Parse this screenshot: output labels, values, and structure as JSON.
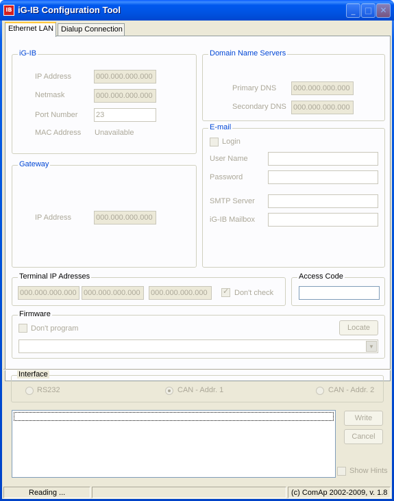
{
  "window": {
    "title": "iG-IB Configuration Tool",
    "icon_text": "IB",
    "icon": "app-icon"
  },
  "tabs": [
    {
      "label": "Ethernet LAN",
      "active": true
    },
    {
      "label": "Dialup Connection",
      "active": false
    }
  ],
  "igib": {
    "legend": "iG-IB",
    "ip_label": "IP Address",
    "ip_value": "000.000.000.000",
    "netmask_label": "Netmask",
    "netmask_value": "000.000.000.000",
    "port_label": "Port Number",
    "port_value": "23",
    "mac_label": "MAC Address",
    "mac_value": "Unavailable"
  },
  "dns": {
    "legend": "Domain Name Servers",
    "primary_label": "Primary DNS",
    "primary_value": "000.000.000.000",
    "secondary_label": "Secondary DNS",
    "secondary_value": "000.000.000.000"
  },
  "gateway": {
    "legend": "Gateway",
    "ip_label": "IP Address",
    "ip_value": "000.000.000.000"
  },
  "email": {
    "legend": "E-mail",
    "login_label": "Login",
    "user_label": "User Name",
    "user_value": "",
    "password_label": "Password",
    "password_value": "",
    "smtp_label": "SMTP Server",
    "smtp_value": "",
    "mailbox_label": "iG-IB Mailbox",
    "mailbox_value": ""
  },
  "terminal": {
    "legend": "Terminal IP Adresses",
    "ips": [
      "000.000.000.000",
      "000.000.000.000",
      "000.000.000.000"
    ],
    "dont_check_label": "Don't check",
    "dont_check_checked": true
  },
  "access": {
    "legend": "Access Code",
    "value": ""
  },
  "firmware": {
    "legend": "Firmware",
    "dont_program_label": "Don't program",
    "locate_label": "Locate",
    "path_value": ""
  },
  "interface": {
    "legend": "Interface",
    "options": [
      {
        "label": "RS232",
        "checked": false
      },
      {
        "label": "CAN - Addr. 1",
        "checked": true
      },
      {
        "label": "CAN - Addr. 2",
        "checked": false
      }
    ]
  },
  "actions": {
    "write_label": "Write",
    "cancel_label": "Cancel",
    "show_hints_label": "Show Hints"
  },
  "status": {
    "text": "Reading ...",
    "middle": "",
    "copyright": "(c) ComAp 2002-2009, v. 1.8"
  }
}
